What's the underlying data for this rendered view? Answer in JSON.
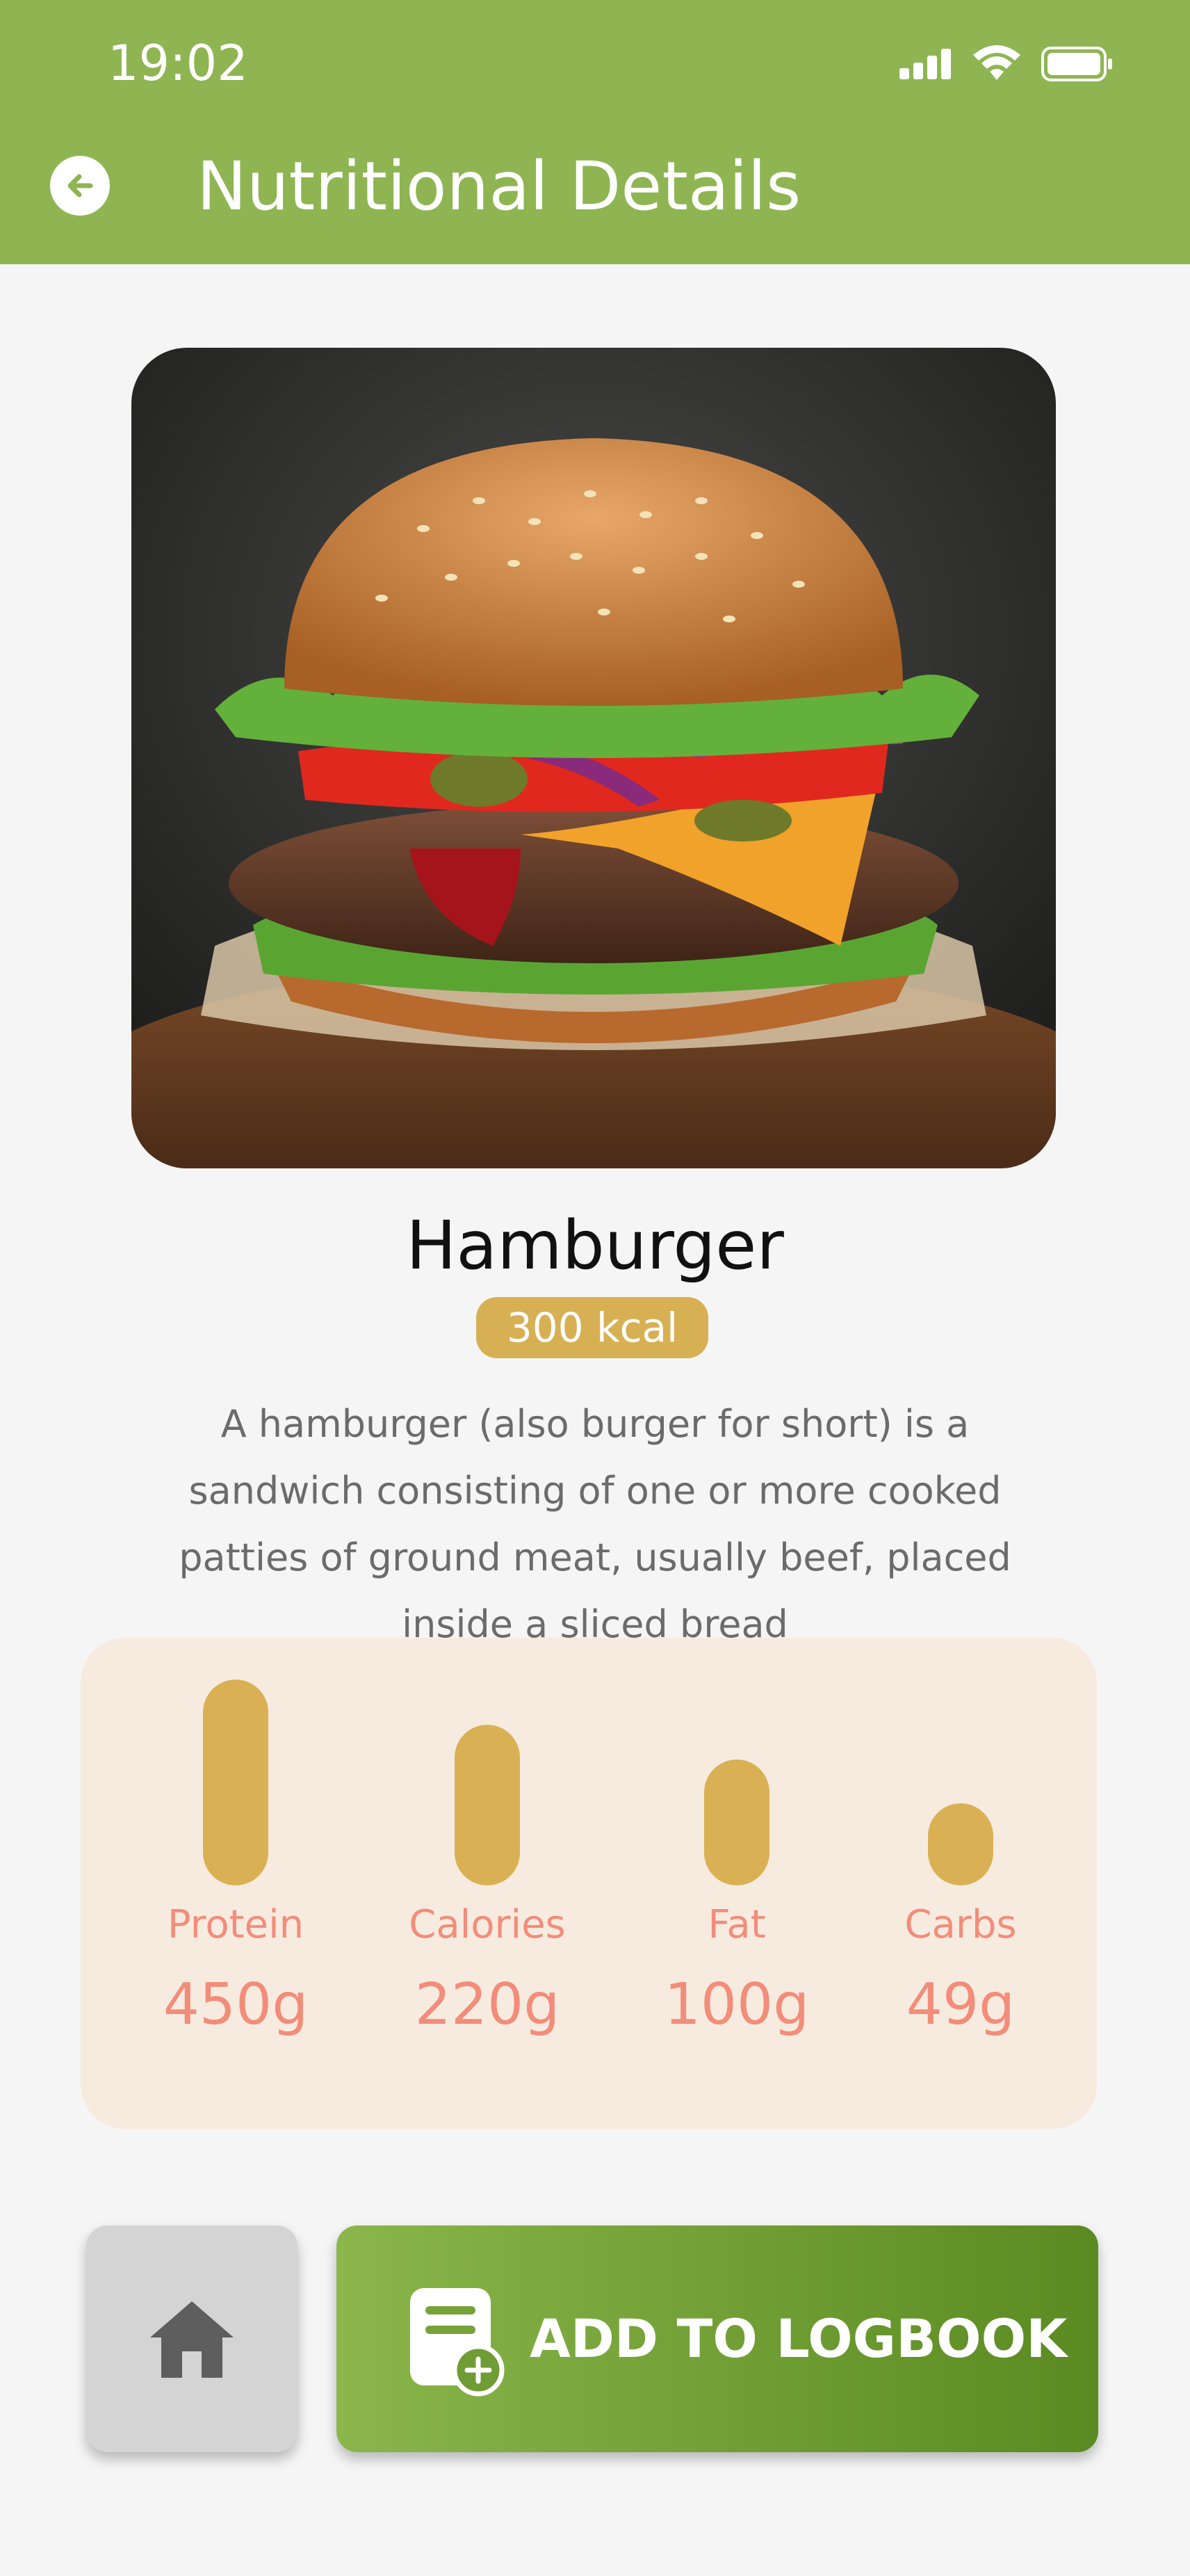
{
  "status_bar": {
    "time": "19:02"
  },
  "header": {
    "title": "Nutritional Details"
  },
  "food": {
    "name": "Hamburger",
    "calories_badge": "300 kcal",
    "description": "A hamburger (also burger for short) is a sandwich consisting of one or more cooked patties of ground meat, usually beef, placed inside a sliced bread"
  },
  "nutrients": [
    {
      "label": "Protein",
      "value": "450g",
      "level": 1.0
    },
    {
      "label": "Calories",
      "value": "220g",
      "level": 0.78
    },
    {
      "label": "Fat",
      "value": "100g",
      "level": 0.61
    },
    {
      "label": "Carbs",
      "value": "49g",
      "level": 0.4
    }
  ],
  "actions": {
    "add_label": "ADD TO LOGBOOK"
  },
  "colors": {
    "header": "#8eb552",
    "accent": "#d9b154",
    "nutrient_text": "#f28d7a"
  }
}
